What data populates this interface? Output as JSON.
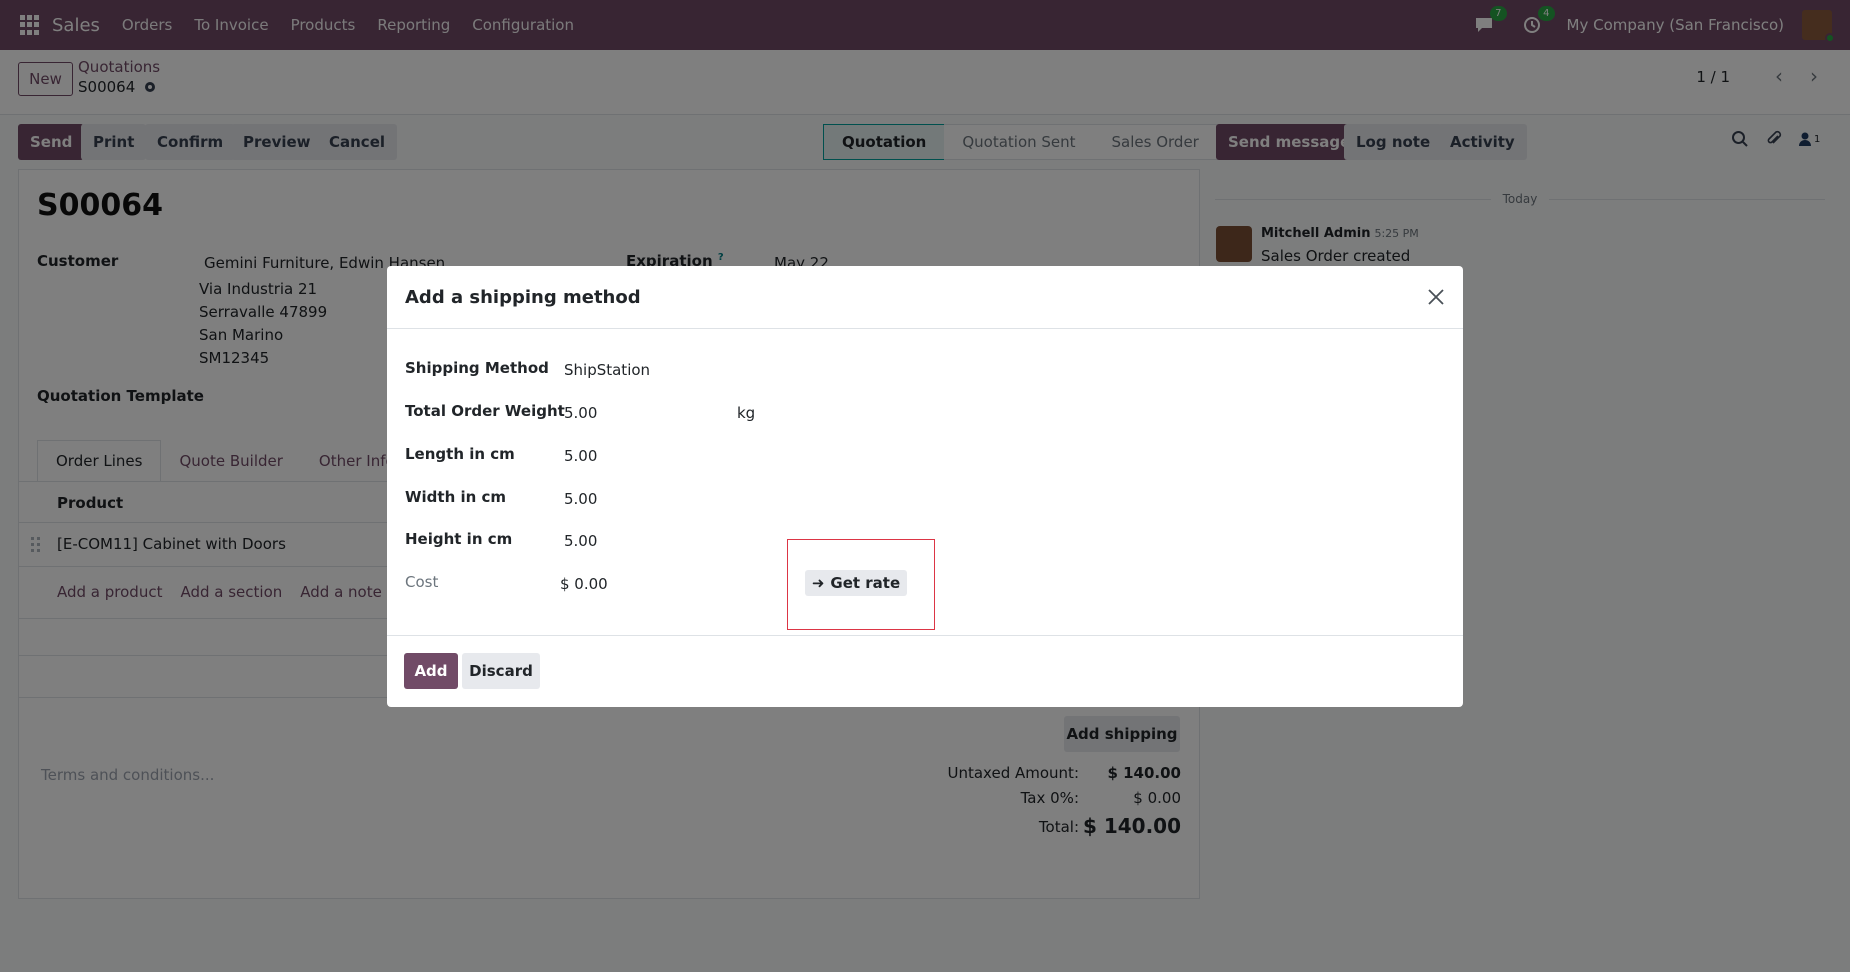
{
  "navbar": {
    "app_name": "Sales",
    "menu": [
      "Orders",
      "To Invoice",
      "Products",
      "Reporting",
      "Configuration"
    ],
    "messages_count": "7",
    "activities_count": "4",
    "company": "My Company (San Francisco)"
  },
  "control_panel": {
    "new_label": "New",
    "breadcrumb_parent": "Quotations",
    "breadcrumb_current": "S00064",
    "pager": "1 / 1"
  },
  "actions": {
    "send": "Send",
    "print": "Print",
    "confirm": "Confirm",
    "preview": "Preview",
    "cancel": "Cancel"
  },
  "status_bar": [
    "Quotation",
    "Quotation Sent",
    "Sales Order"
  ],
  "form": {
    "name": "S00064",
    "customer_label": "Customer",
    "customer_name": "Gemini Furniture, Edwin Hansen",
    "address": [
      "Via Industria 21",
      "Serravalle 47899",
      "San Marino",
      "SM12345"
    ],
    "expiration_label": "Expiration",
    "expiration_help": "?",
    "expiration_value": "May 22",
    "template_label": "Quotation Template",
    "tabs": [
      "Order Lines",
      "Quote Builder",
      "Other Info"
    ],
    "column_product": "Product",
    "line_product": "[E-COM11] Cabinet with Doors",
    "add_product": "Add a product",
    "add_section": "Add a section",
    "add_note": "Add a note",
    "add_shipping": "Add shipping",
    "terms_placeholder": "Terms and conditions...",
    "untaxed_label": "Untaxed Amount:",
    "untaxed_value": "$ 140.00",
    "tax_label": "Tax 0%:",
    "tax_value": "$ 0.00",
    "total_label": "Total:",
    "total_value": "$ 140.00"
  },
  "chatter": {
    "send_message": "Send message",
    "log_note": "Log note",
    "activity": "Activity",
    "followers_count": "1",
    "date_separator": "Today",
    "author": "Mitchell Admin",
    "time": "5:25 PM",
    "body": "Sales Order created"
  },
  "modal": {
    "title": "Add a shipping method",
    "fields": {
      "shipping_method_label": "Shipping Method",
      "shipping_method_value": "ShipStation",
      "weight_label": "Total Order Weight",
      "weight_value": "5.00",
      "weight_unit": "kg",
      "length_label": "Length in cm",
      "length_value": "5.00",
      "width_label": "Width in cm",
      "width_value": "5.00",
      "height_label": "Height in cm",
      "height_value": "5.00",
      "cost_label": "Cost",
      "cost_value": "$ 0.00"
    },
    "get_rate": "Get rate",
    "add": "Add",
    "discard": "Discard"
  },
  "colors": {
    "brand": "#714b67",
    "highlight": "#dc3545"
  }
}
